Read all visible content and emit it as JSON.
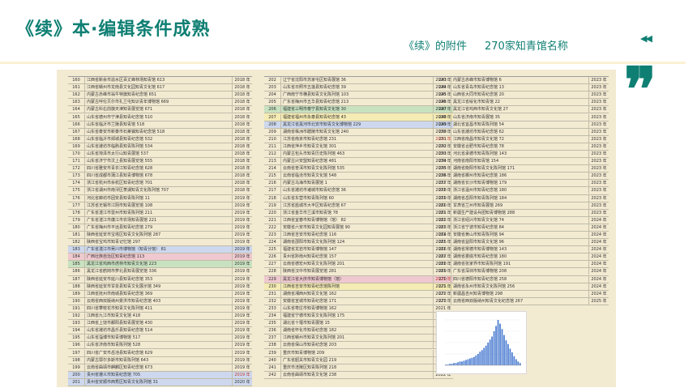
{
  "header": {
    "title": "《续》本·编辑条件成熟",
    "subtitle_part1": "《续》的附件",
    "subtitle_part2": "270家知青馆名称",
    "nav_glyph": "◀◀",
    "quote_glyph": "❞"
  },
  "colors": {
    "accent": "#0f7f73",
    "panel": "#f3ead2",
    "green": "#c8e2c0",
    "blue": "#cdd8ee",
    "pink": "#efc9cf",
    "yellow": "#f5ebb4"
  },
  "table": {
    "columns": [
      {
        "rows": [
          {
            "n": "160",
            "name": "江西省新余市渝水区百丈峰林场知青馆 613",
            "y": "2018 年"
          },
          {
            "n": "161",
            "name": "江西省赣州市龙南县文化园知青文化馆 617",
            "y": "2018 年"
          },
          {
            "n": "162",
            "name": "内蒙古赤峰市翁牛特旗知青纪念馆 651",
            "y": "2018 年"
          },
          {
            "n": "163",
            "name": "内蒙古呼伦贝尔市扎兰屯知识青年博物馆 669",
            "y": "2018 年"
          },
          {
            "n": "164",
            "name": "内蒙古科右前旗天津知青展览馆 671",
            "y": "2018 年"
          },
          {
            "n": "165",
            "name": "山东省德州市宁津县知青纪念馆 510",
            "y": "2018 年"
          },
          {
            "n": "166",
            "name": "山东省临沂市兰陵县知青馆 518",
            "y": "2018 年"
          },
          {
            "n": "167",
            "name": "山东省泰安市新泰市石莱镇知青纪念馆 518",
            "y": "2018 年"
          },
          {
            "n": "168",
            "name": "山东省临沂市郯城县知青纪念馆 532",
            "y": "2018 年"
          },
          {
            "n": "169",
            "name": "山东省潍坊市临朐县知青陈列馆 534",
            "y": "2018 年"
          },
          {
            "n": "170",
            "name": "山东省菏泽市太行山知青展馆 537",
            "y": "2018 年"
          },
          {
            "n": "171",
            "name": "山东省济宁市汶上县知青展览馆 555",
            "y": "2018 年"
          },
          {
            "n": "172",
            "name": "四川省雅安市青衣江知青纪念馆 628",
            "y": "2018 年"
          },
          {
            "n": "173",
            "name": "四川省成都市蒲江县知青博物馆 678",
            "y": "2018 年"
          },
          {
            "n": "174",
            "name": "浙江省杭州市余杭区知青纪念馆 701",
            "y": "2018 年"
          },
          {
            "n": "175",
            "name": "浙江省湖州市南浔区菱湖知青文化陈列馆 707",
            "y": "2018 年"
          },
          {
            "n": "176",
            "name": "河北省廊坊市固安县知青陈列馆 11",
            "y": "2019 年"
          },
          {
            "n": "177",
            "name": "江苏省无锡市江阴市知青展览馆 108",
            "y": "2019 年"
          },
          {
            "n": "178",
            "name": "广东省湛江市雷州市知青陈列馆 211",
            "y": "2019 年"
          },
          {
            "n": "179",
            "name": "广东省湛江市廉江市农场知青展馆 221",
            "y": "2019 年"
          },
          {
            "n": "180",
            "name": "广东省梅州市平远县知青纪念馆 279",
            "y": "2019 年"
          },
          {
            "n": "181",
            "name": "陕西省延安市宝塔区知青文化陈列馆 287",
            "y": "2019 年"
          },
          {
            "n": "182",
            "name": "陕西省宝鸡市知青记忆馆 297",
            "y": "2019 年"
          },
          {
            "n": "183",
            "name": "广东省湛江市吴川市博物馆（知青分馆） 81",
            "y": "2019 年",
            "hl": "blue"
          },
          {
            "n": "184",
            "name": "广西壮族自治区知青纪念馆 113",
            "y": "2019 年",
            "hl": "pink"
          },
          {
            "n": "185",
            "name": "黑龙江省鸡西市虎林市知青文化馆 223",
            "y": "2019 年",
            "hl": "green"
          },
          {
            "n": "186",
            "name": "黑龙江省鹤岗市萝北县知青展览馆 336",
            "y": "2019 年"
          },
          {
            "n": "187",
            "name": "陕西省延安市延川县知青纪念馆 353",
            "y": "2019 年"
          },
          {
            "n": "188",
            "name": "陕西省延安市甘泉县知青文化展示馆 349",
            "y": "2019 年"
          },
          {
            "n": "189",
            "name": "江西省抚州市南城县知青纪念馆 369",
            "y": "2019 年"
          },
          {
            "n": "190",
            "name": "云南省西双版纳州景洪市知青纪念馆 403",
            "y": "2019 年"
          },
          {
            "n": "191",
            "name": "四川省攀枝花市知青文化陈列馆 411",
            "y": "2019 年"
          },
          {
            "n": "192",
            "name": "江西省九江市知青文化馆 418",
            "y": "2019 年"
          },
          {
            "n": "193",
            "name": "江西省上饶市鄱阳县知青展览馆 430",
            "y": "2019 年"
          },
          {
            "n": "194",
            "name": "山东省潍坊市昌乐县知青纪念馆 514",
            "y": "2019 年"
          },
          {
            "n": "195",
            "name": "山东省淄博市知青博物馆 517",
            "y": "2019 年"
          },
          {
            "n": "196",
            "name": "山东省济南市知青陈列馆 528",
            "y": "2019 年"
          },
          {
            "n": "197",
            "name": "四川省广安市岳池县知青纪念馆 629",
            "y": "2019 年"
          },
          {
            "n": "198",
            "name": "内蒙古鄂尔多斯市知青陈列馆 643",
            "y": "2019 年"
          },
          {
            "n": "199",
            "name": "云南省曲靖市麒麟区知青纪念馆 673",
            "y": "2019 年"
          },
          {
            "n": "200",
            "name": "贵州省遵义市知青纪念馆 705",
            "y": "2019 年",
            "hl": "blue",
            "red": true
          },
          {
            "n": "201",
            "name": "贵州省安顺市西秀区知青文化陈列馆 31",
            "y": "2020 年",
            "hl": "blue"
          }
        ]
      },
      {
        "rows": [
          {
            "n": "202",
            "name": "辽宁省沈阳市苏家屯区知青展馆 36",
            "y": "2020 年"
          },
          {
            "n": "203",
            "name": "山东省日照市五莲县知青纪念馆 39",
            "y": "2020 年"
          },
          {
            "n": "204",
            "name": "广西南宁市横县知青文化陈列馆 103",
            "y": "2020 年"
          },
          {
            "n": "205",
            "name": "广东省梅州市五华县知青纪念馆 213",
            "y": "2020 年"
          },
          {
            "n": "206",
            "name": "福建省三明市泰宁县知青文化馆 30",
            "y": "2020 年",
            "hl": "green"
          },
          {
            "n": "207",
            "name": "福建省福州市永泰县知青纪念馆 43",
            "y": "2020 年",
            "hl": "yellow"
          },
          {
            "n": "208",
            "name": "黑龙江省黑河市北安市知青文化博物馆 229",
            "y": "2020 年",
            "hl": "blue"
          },
          {
            "n": "209",
            "name": "湖南省株洲市醴陵市知青文化馆 240",
            "y": "2020 年"
          },
          {
            "n": "210",
            "name": "江苏省南京市知青纪念馆 231",
            "y": "2020 年",
            "red": true
          },
          {
            "n": "211",
            "name": "江西省萍乡市知青文化馆 301",
            "y": "2020 年"
          },
          {
            "n": "212",
            "name": "内蒙古包头市知青历史陈列馆 463",
            "y": "2020 年"
          },
          {
            "n": "213",
            "name": "内蒙古兴安盟知青纪念馆 481",
            "y": "2020 年"
          },
          {
            "n": "214",
            "name": "云南省普洱市知青文化陈列馆 535",
            "y": "2020 年"
          },
          {
            "n": "215",
            "name": "云南省临沧市知青文化馆 548",
            "y": "2020 年"
          },
          {
            "n": "216",
            "name": "内蒙古乌海市知青展馆 1",
            "y": "2021 年"
          },
          {
            "n": "217",
            "name": "山东省潍坊市诸城市知青纪念馆 36",
            "y": "2021 年"
          },
          {
            "n": "218",
            "name": "山东省东营市知青陈列馆 60",
            "y": "2021 年"
          },
          {
            "n": "219",
            "name": "江苏省盐城市大丰区知青纪念馆 67",
            "y": "2021 年"
          },
          {
            "n": "220",
            "name": "浙江省金华市兰溪市知青馆 78",
            "y": "2021 年"
          },
          {
            "n": "221",
            "name": "江西省宜春市知青博物馆（馆） 82",
            "y": "2021 年"
          },
          {
            "n": "222",
            "name": "安徽省六安市知青文化园知青展馆 90",
            "y": "2021 年"
          },
          {
            "n": "223",
            "name": "江西省吉安市知青纪念馆 116",
            "y": "2021 年"
          },
          {
            "n": "224",
            "name": "湖南省邵阳市知青文化陈列馆 124",
            "y": "2021 年"
          },
          {
            "n": "225",
            "name": "福建省龙岩市知青博物馆 147",
            "y": "2021 年"
          },
          {
            "n": "226",
            "name": "贵州省黔南州知青纪念馆 157",
            "y": "2021 年"
          },
          {
            "n": "227",
            "name": "云南省德宏州知青文化陈列馆 201",
            "y": "2021 年"
          },
          {
            "n": "228",
            "name": "陕西省汉中市知青展览馆 281",
            "y": "2021 年"
          },
          {
            "n": "229",
            "name": "黑龙江省大庆市知青博物馆（馆）",
            "y": "2021 年",
            "hl": "pink",
            "red": true
          },
          {
            "n": "230",
            "name": "江西省吉安市知青纪念馆陈列馆",
            "y": "2021 年",
            "hl": "yellow"
          },
          {
            "n": "231",
            "name": "湖南省湘西州知青文化馆 162",
            "y": "2021 年"
          },
          {
            "n": "232",
            "name": "安徽省宣城市知青纪念馆 171",
            "y": "2021 年"
          },
          {
            "n": "233",
            "name": "山东省枣庄市知青博物馆 162",
            "y": "2021 年"
          },
          {
            "n": "234",
            "name": "福建省宁德市知青文化陈列馆 175",
            "y": "2021 年"
          },
          {
            "n": "235",
            "name": "湖北省十堰市知青展馆 15",
            "y": "2022 年"
          },
          {
            "n": "236",
            "name": "湖南省怀化市知青纪念馆 182",
            "y": "2022 年"
          },
          {
            "n": "237",
            "name": "江西省赣州市知青文化陈列馆 201",
            "y": "2022 年"
          },
          {
            "n": "238",
            "name": "云南省保山市知青纪念馆 203",
            "y": "2022 年"
          },
          {
            "n": "239",
            "name": "重庆市知青博物馆 209",
            "y": "2022 年"
          },
          {
            "n": "240",
            "name": "广东省韶关市知青文化园 219",
            "y": "2022 年"
          },
          {
            "n": "241",
            "name": "重庆市涪陵区知青陈列馆 218",
            "y": "2022 年"
          },
          {
            "n": "242",
            "name": "云南省曲靖市知青文化馆 238",
            "y": "2022 年"
          }
        ]
      },
      {
        "rows": [
          {
            "n": "243",
            "name": "内蒙古赤峰市知青博物馆 6",
            "y": "2023 年"
          },
          {
            "n": "244",
            "name": "山东省青岛市知青纪念馆 13",
            "y": "2023 年"
          },
          {
            "n": "245",
            "name": "山西省大同市知青纪念馆 20",
            "y": "2023 年"
          },
          {
            "n": "246",
            "name": "黑龙江省绥化市知青馆 22",
            "y": "2023 年"
          },
          {
            "n": "247",
            "name": "黑龙江省鸡西市知青文化馆 27",
            "y": "2023 年"
          },
          {
            "n": "248",
            "name": "山东省济南市知青展馆 35",
            "y": "2023 年"
          },
          {
            "n": "249",
            "name": "湖北省宜昌市知青陈列馆 54",
            "y": "2023 年"
          },
          {
            "n": "250",
            "name": "山东省潍坊市知青纪念馆 62",
            "y": "2023 年"
          },
          {
            "n": "251",
            "name": "江西省南昌市知青文化馆 72",
            "y": "2023 年"
          },
          {
            "n": "252",
            "name": "安徽省合肥市知青纪念馆 78",
            "y": "2023 年"
          },
          {
            "n": "253",
            "name": "河北省承德市知青陈列馆 143",
            "y": "2023 年"
          },
          {
            "n": "254",
            "name": "河南省南阳市知青馆 154",
            "y": "2023 年"
          },
          {
            "n": "255",
            "name": "湖南省衡阳市知青文化陈列馆 171",
            "y": "2023 年"
          },
          {
            "n": "256",
            "name": "湖南省郴州市知青纪念馆 186",
            "y": "2023 年"
          },
          {
            "n": "257",
            "name": "湖南省长沙市知青博物馆 179",
            "y": "2023 年"
          },
          {
            "n": "258",
            "name": "浙江省温州市知青纪念馆 180",
            "y": "2023 年"
          },
          {
            "n": "259",
            "name": "湖南省岳阳市知青陈列馆 184",
            "y": "2023 年"
          },
          {
            "n": "260",
            "name": "甘肃省兰州市知青展馆 269",
            "y": "2023 年"
          },
          {
            "n": "261",
            "name": "新疆生产建设兵团知青博物馆 288",
            "y": "2023 年"
          },
          {
            "n": "262",
            "name": "浙江省绍兴市知青文化馆 74",
            "y": "2024 年"
          },
          {
            "n": "263",
            "name": "浙江省宁波市知青纪念馆 84",
            "y": "2024 年"
          },
          {
            "n": "264",
            "name": "安徽省黄山市知青陈列馆 94",
            "y": "2024 年"
          },
          {
            "n": "265",
            "name": "湖南省益阳市知青文化馆 96",
            "y": "2024 年"
          },
          {
            "n": "266",
            "name": "湖南省常德市知青博物馆 143",
            "y": "2024 年"
          },
          {
            "n": "267",
            "name": "湖南省娄底市知青纪念馆 180",
            "y": "2024 年"
          },
          {
            "n": "268",
            "name": "湖南省张家界市知青陈列馆 191",
            "y": "2024 年"
          },
          {
            "n": "269",
            "name": "广东省深圳市知青博物馆 208",
            "y": "2024 年"
          },
          {
            "n": "270",
            "name": "四川省德阳市知青纪念馆 258",
            "y": "2024 年"
          },
          {
            "n": "271",
            "name": "湖南省永州市知青文化陈列馆 256",
            "y": "2024 年"
          },
          {
            "n": "272",
            "name": "新疆昌吉州知青博物馆 298",
            "y": "2024 年"
          },
          {
            "n": "273",
            "name": "云南省西双版纳州知青文化纪念馆 267",
            "y": "2025 年"
          }
        ]
      }
    ]
  },
  "chart_data": {
    "type": "bar",
    "title": "",
    "xlabel": "",
    "ylabel": "",
    "values": [
      1,
      1,
      2,
      2,
      3,
      3,
      4,
      5,
      5,
      6,
      7,
      8,
      9,
      10,
      11,
      13,
      15,
      18,
      20,
      23,
      26,
      30,
      34,
      38,
      45,
      52,
      60,
      55,
      48,
      40,
      33,
      28,
      22,
      17,
      12,
      8,
      5,
      3
    ]
  }
}
